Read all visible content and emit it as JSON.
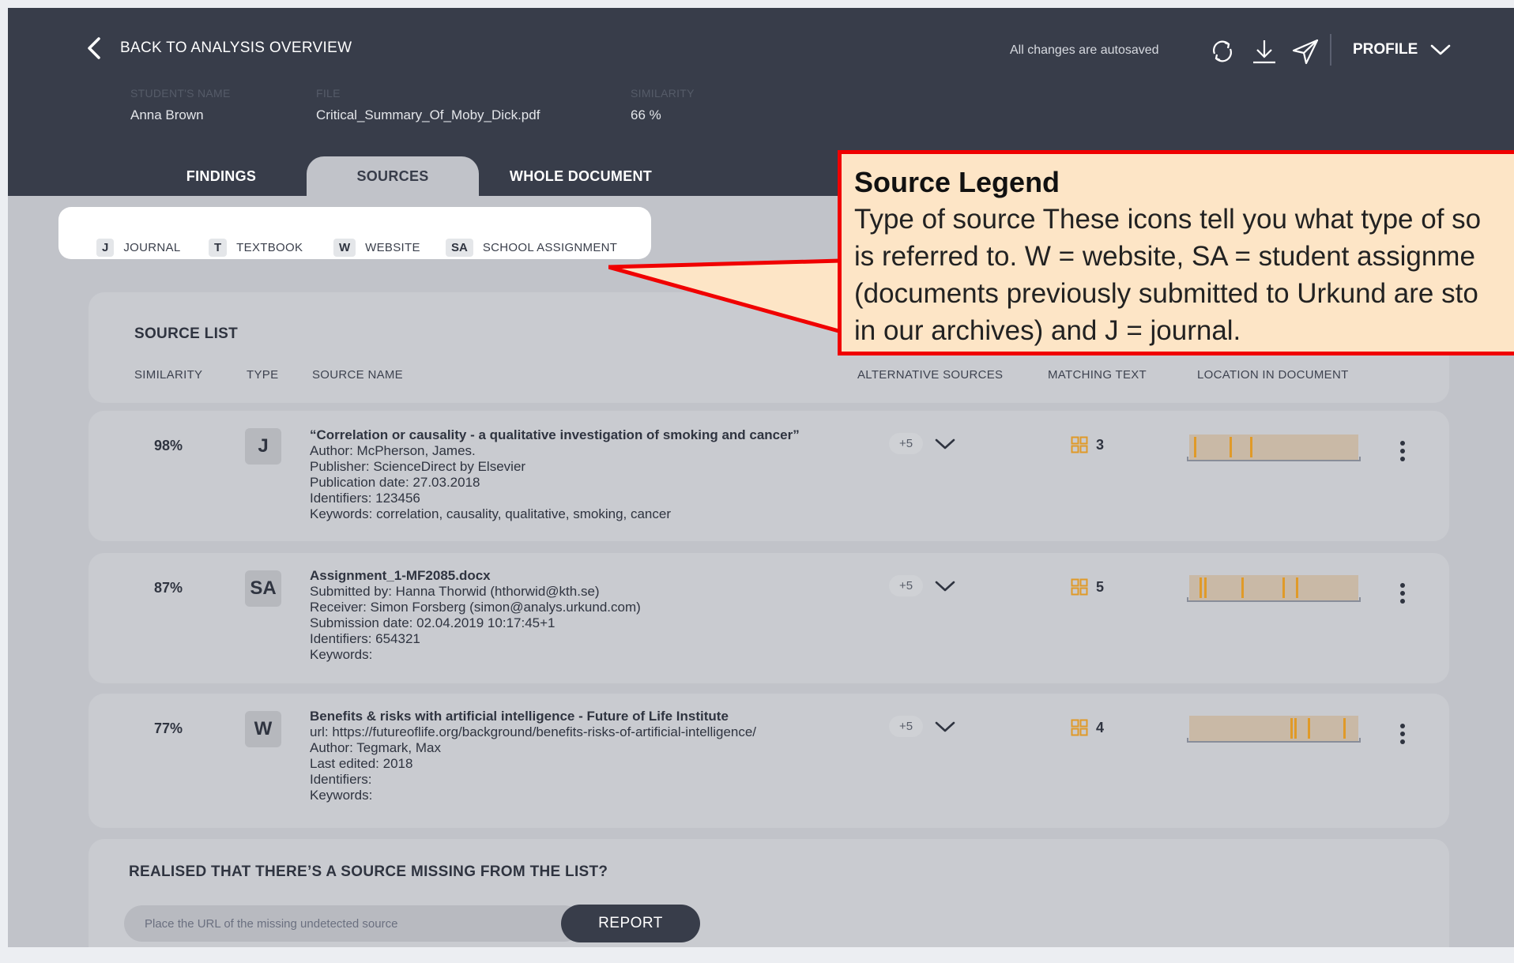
{
  "header": {
    "back_label": "BACK TO ANALYSIS OVERVIEW",
    "autosave_text": "All changes are autosaved",
    "profile_label": "PROFILE",
    "icons": [
      "refresh-icon",
      "download-icon",
      "send-icon",
      "chevron-down-icon"
    ]
  },
  "meta": {
    "student_label": "STUDENT'S NAME",
    "student_value": "Anna Brown",
    "file_label": "FILE",
    "file_value": "Critical_Summary_Of_Moby_Dick.pdf",
    "similarity_label": "SIMILARITY",
    "similarity_value": "66 %"
  },
  "tabs": [
    {
      "label": "FINDINGS",
      "active": false
    },
    {
      "label": "SOURCES",
      "active": true
    },
    {
      "label": "WHOLE DOCUMENT",
      "active": false
    }
  ],
  "legend": [
    {
      "code": "J",
      "label": "JOURNAL"
    },
    {
      "code": "T",
      "label": "TEXTBOOK"
    },
    {
      "code": "W",
      "label": "WEBSITE"
    },
    {
      "code": "SA",
      "label": "SCHOOL ASSIGNMENT"
    }
  ],
  "callout": {
    "title": "Source Legend",
    "lines": [
      "Type of source These icons tell you what type of so",
      "is referred to. W = website, SA = student assignme",
      "(documents previously submitted to Urkund are sto",
      "in our archives) and J = journal."
    ]
  },
  "source_list": {
    "title": "SOURCE LIST",
    "columns": [
      "SIMILARITY",
      "TYPE",
      "SOURCE NAME",
      "ALTERNATIVE SOURCES",
      "MATCHING TEXT",
      "LOCATION IN DOCUMENT"
    ],
    "rows": [
      {
        "similarity": "98%",
        "type": "J",
        "name": "“Correlation or causality - a qualitative investigation of smoking and cancer”",
        "details": [
          "Author: McPherson, James.",
          "Publisher: ScienceDirect by Elsevier",
          "Publication date: 27.03.2018",
          "Identifiers: 123456",
          "Keywords: correlation, causality, qualitative, smoking, cancer"
        ],
        "alternatives": "+5",
        "matches": "3",
        "location_marks": [
          0.03,
          0.24,
          0.36
        ]
      },
      {
        "similarity": "87%",
        "type": "SA",
        "name": "Assignment_1-MF2085.docx",
        "details": [
          "Submitted by: Hanna Thorwid (hthorwid@kth.se)",
          "Receiver: Simon Forsberg (simon@analys.urkund.com)",
          "Submission date: 02.04.2019 10:17:45+1",
          "Identifiers: 654321",
          "Keywords:"
        ],
        "alternatives": "+5",
        "matches": "5",
        "location_marks": [
          0.06,
          0.09,
          0.31,
          0.55,
          0.63
        ]
      },
      {
        "similarity": "77%",
        "type": "W",
        "name": "Benefits & risks with artificial intelligence - Future of Life Institute",
        "details": [
          "url: https://futureoflife.org/background/benefits-risks-of-artificial-intelligence/",
          "Author: Tegmark, Max",
          "Last edited: 2018",
          "Identifiers:",
          "Keywords:"
        ],
        "alternatives": "+5",
        "matches": "4",
        "location_marks": [
          0.6,
          0.62,
          0.7,
          0.91
        ]
      }
    ]
  },
  "missing": {
    "title": "REALISED THAT THERE’S A SOURCE MISSING FROM THE LIST?",
    "placeholder": "Place the URL of the missing undetected source",
    "button": "REPORT"
  }
}
